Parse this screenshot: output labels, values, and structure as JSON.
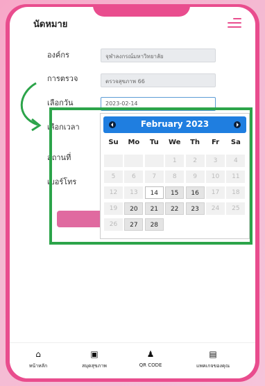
{
  "header": {
    "title": "นัดหมาย",
    "menu_icon": "hamburger-icon"
  },
  "form": {
    "org_label": "องค์กร",
    "org_value": "จุฬาลงกรณ์มหาวิทยาลัย",
    "exam_label": "การตรวจ",
    "exam_value": "ตรวจสุขภาพ 66",
    "date_label": "เลือกวัน",
    "date_value": "2023-02-14",
    "time_label": "เลือกเวลา",
    "place_label": "สถานที่",
    "phone_label": "เบอร์โทร"
  },
  "calendar": {
    "month_title": "February 2023",
    "weekdays": [
      "Su",
      "Mo",
      "Tu",
      "We",
      "Th",
      "Fr",
      "Sa"
    ],
    "weeks": [
      [
        {
          "d": "",
          "s": "disabled"
        },
        {
          "d": "",
          "s": "disabled"
        },
        {
          "d": "",
          "s": "disabled"
        },
        {
          "d": "1",
          "s": "disabled"
        },
        {
          "d": "2",
          "s": "disabled"
        },
        {
          "d": "3",
          "s": "disabled"
        },
        {
          "d": "4",
          "s": "disabled"
        }
      ],
      [
        {
          "d": "5",
          "s": "disabled"
        },
        {
          "d": "6",
          "s": "disabled"
        },
        {
          "d": "7",
          "s": "disabled"
        },
        {
          "d": "8",
          "s": "disabled"
        },
        {
          "d": "9",
          "s": "disabled"
        },
        {
          "d": "10",
          "s": "disabled"
        },
        {
          "d": "11",
          "s": "disabled"
        }
      ],
      [
        {
          "d": "12",
          "s": "disabled"
        },
        {
          "d": "13",
          "s": "disabled"
        },
        {
          "d": "14",
          "s": "today"
        },
        {
          "d": "15",
          "s": "enabled"
        },
        {
          "d": "16",
          "s": "enabled"
        },
        {
          "d": "17",
          "s": "disabled"
        },
        {
          "d": "18",
          "s": "disabled"
        }
      ],
      [
        {
          "d": "19",
          "s": "disabled"
        },
        {
          "d": "20",
          "s": "enabled"
        },
        {
          "d": "21",
          "s": "enabled"
        },
        {
          "d": "22",
          "s": "enabled"
        },
        {
          "d": "23",
          "s": "enabled"
        },
        {
          "d": "24",
          "s": "disabled"
        },
        {
          "d": "25",
          "s": "disabled"
        }
      ],
      [
        {
          "d": "26",
          "s": "disabled"
        },
        {
          "d": "27",
          "s": "enabled"
        },
        {
          "d": "28",
          "s": "enabled"
        }
      ]
    ]
  },
  "bottom_nav": [
    {
      "label": "หน้าหลัก",
      "icon": "home-icon",
      "glyph": "⌂"
    },
    {
      "label": "สมุดสุขภาพ",
      "icon": "health-book-icon",
      "glyph": "▣"
    },
    {
      "label": "QR CODE",
      "icon": "person-icon",
      "glyph": "♟"
    },
    {
      "label": "แพคเกจของคุณ",
      "icon": "package-icon",
      "glyph": "▤"
    }
  ],
  "colors": {
    "accent": "#e94d8e",
    "calendar_header": "#1f7ee0",
    "highlight_box": "#2ca44a"
  }
}
